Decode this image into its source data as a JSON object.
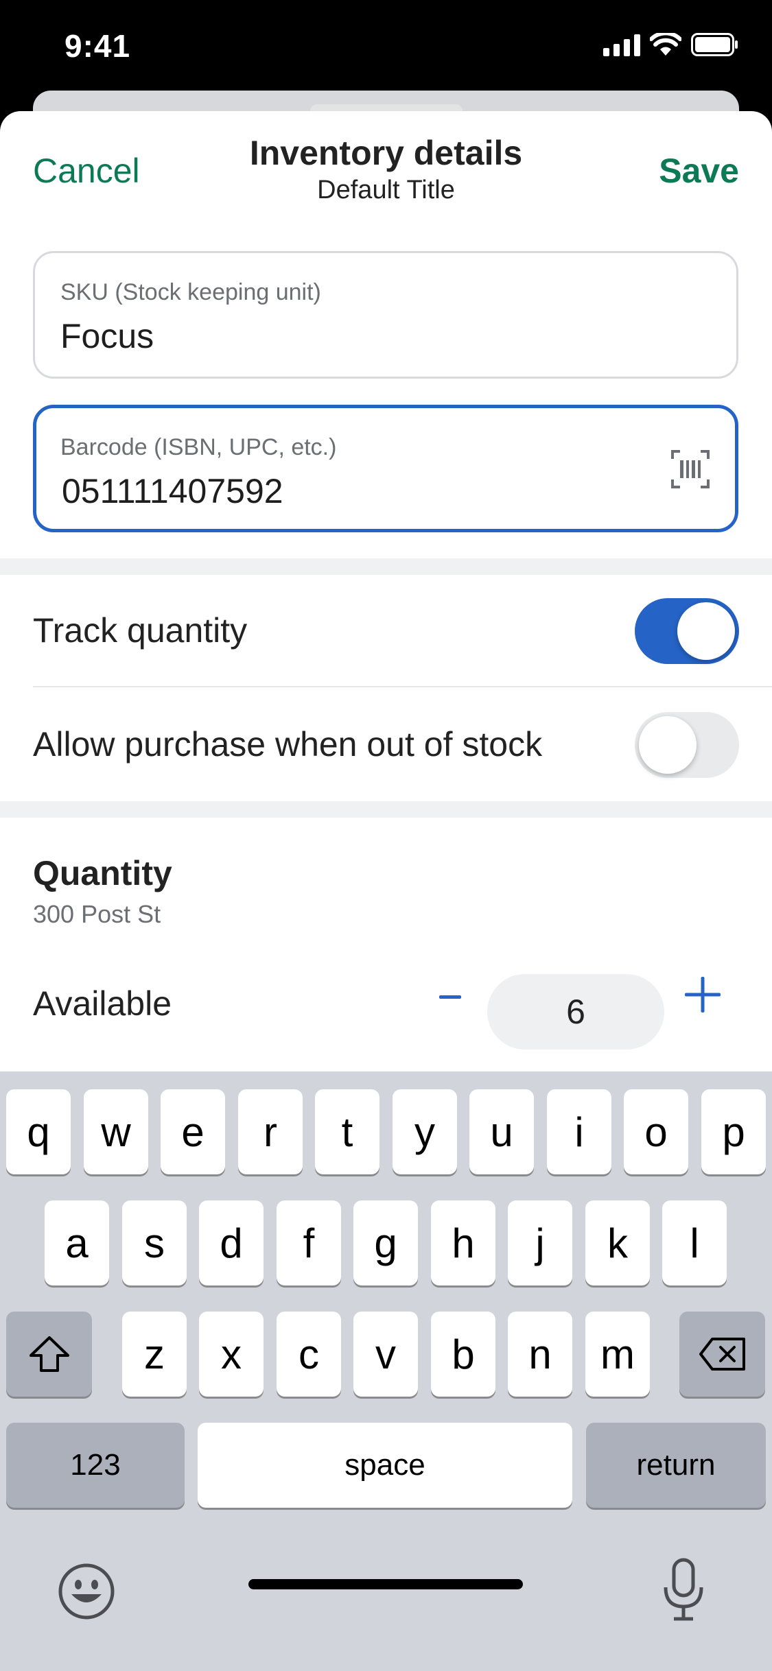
{
  "status_bar": {
    "time": "9:41"
  },
  "nav": {
    "cancel_label": "Cancel",
    "title": "Inventory details",
    "subtitle": "Default Title",
    "save_label": "Save"
  },
  "fields": {
    "sku": {
      "label": "SKU (Stock keeping unit)",
      "value": "Focus"
    },
    "barcode": {
      "label": "Barcode (ISBN, UPC, etc.)",
      "value": "051111407592"
    }
  },
  "settings": {
    "track_quantity": {
      "label": "Track quantity",
      "enabled": true
    },
    "allow_purchase": {
      "label": "Allow purchase when out of stock",
      "enabled": false
    }
  },
  "quantity": {
    "title": "Quantity",
    "location": "300 Post St",
    "available_label": "Available",
    "available_value": "6"
  },
  "keyboard": {
    "row1": [
      "q",
      "w",
      "e",
      "r",
      "t",
      "y",
      "u",
      "i",
      "o",
      "p"
    ],
    "row2": [
      "a",
      "s",
      "d",
      "f",
      "g",
      "h",
      "j",
      "k",
      "l"
    ],
    "row3": [
      "z",
      "x",
      "c",
      "v",
      "b",
      "n",
      "m"
    ],
    "numbers_label": "123",
    "space_label": "space",
    "return_label": "return"
  },
  "colors": {
    "accent_green": "#0b7a55",
    "accent_blue": "#2563c6"
  }
}
